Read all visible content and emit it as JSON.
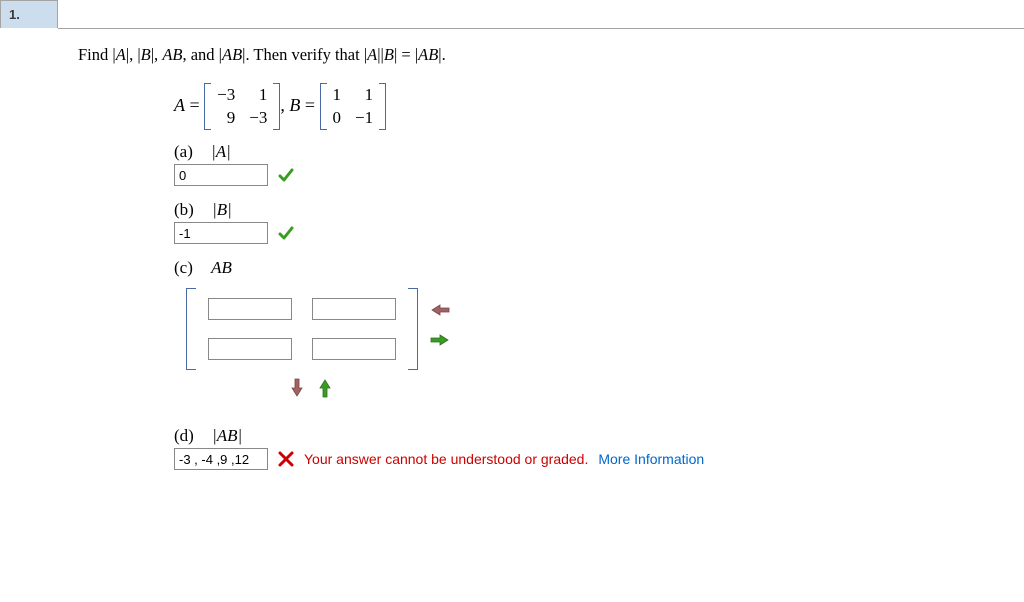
{
  "tab": "1.",
  "prompt_prefix": "Find |",
  "prompt_A": "A",
  "prompt_mid1": "|, |",
  "prompt_B": "B",
  "prompt_mid2": "|, ",
  "prompt_AB": "AB",
  "prompt_mid3": ", and |",
  "prompt_AB2": "AB",
  "prompt_mid4": "|. Then verify that  |",
  "prompt_A2": "A",
  "prompt_mid5": "||",
  "prompt_B2": "B",
  "prompt_mid6": "| = |",
  "prompt_AB3": "AB",
  "prompt_end": "|.",
  "matA_label": "A",
  "eq": " = ",
  "matB_label": "B",
  "comma": ", ",
  "matrixA": [
    "−3",
    "1",
    "9",
    "−3"
  ],
  "matrixB": [
    "1",
    "1",
    "0",
    "−1"
  ],
  "parts": {
    "a": {
      "letter": "(a)",
      "label": "|A|",
      "value": "0",
      "status": "correct"
    },
    "b": {
      "letter": "(b)",
      "label": "|B|",
      "value": "-1",
      "status": "correct"
    },
    "c": {
      "letter": "(c)",
      "label": "AB"
    },
    "d": {
      "letter": "(d)",
      "label": "|AB|",
      "value": "-3 , -4 ,9 ,12",
      "status": "wrong"
    }
  },
  "error_msg": "Your answer cannot be understood or graded. ",
  "more_info": "More Information"
}
